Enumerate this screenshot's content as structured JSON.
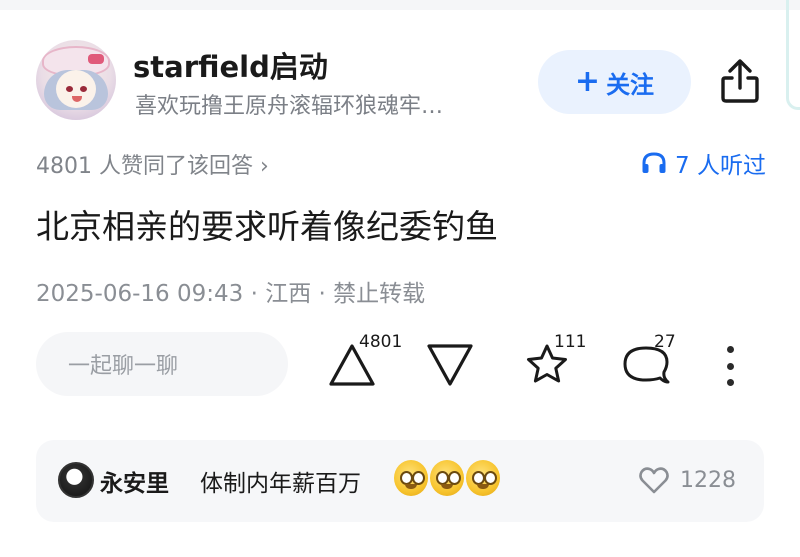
{
  "author": {
    "name": "starfield启动",
    "bio": "喜欢玩撸王原舟滚辐环狼魂牢…"
  },
  "header": {
    "follow_label": "关注",
    "follow_plus": "+",
    "share_icon": "share-icon"
  },
  "answer": {
    "likes_text": "4801 人赞同了该回答",
    "likes_chevron": "›",
    "listen_text": "7 人听过",
    "title": "北京相亲的要求听着像纪委钓鱼",
    "meta": "2025-06-16 09:43 · 江西 · 禁止转载"
  },
  "actions": {
    "chat_placeholder": "一起聊一聊",
    "upvote_count": "4801",
    "star_count": "111",
    "comment_count": "27"
  },
  "hot_comment": {
    "name": "永安里",
    "text": "体制内年薪百万",
    "emojis": [
      "drooling-face",
      "drooling-face",
      "drooling-face"
    ],
    "likes": "1228"
  },
  "colors": {
    "accent": "#1a6cf0",
    "follow_bg": "#eaf2fe",
    "muted": "#80848a"
  }
}
